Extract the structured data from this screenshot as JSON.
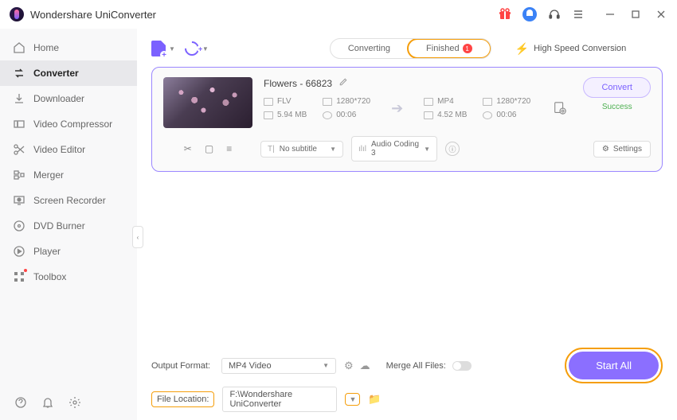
{
  "app": {
    "title": "Wondershare UniConverter"
  },
  "sidebar": {
    "items": [
      {
        "label": "Home"
      },
      {
        "label": "Converter"
      },
      {
        "label": "Downloader"
      },
      {
        "label": "Video Compressor"
      },
      {
        "label": "Video Editor"
      },
      {
        "label": "Merger"
      },
      {
        "label": "Screen Recorder"
      },
      {
        "label": "DVD Burner"
      },
      {
        "label": "Player"
      },
      {
        "label": "Toolbox"
      }
    ]
  },
  "topbar": {
    "tabs": {
      "converting": "Converting",
      "finished": "Finished",
      "finished_count": "1"
    },
    "high_speed": "High Speed Conversion"
  },
  "task": {
    "title": "Flowers - 66823",
    "src": {
      "format": "FLV",
      "res": "1280*720",
      "size": "5.94 MB",
      "dur": "00:06"
    },
    "dst": {
      "format": "MP4",
      "res": "1280*720",
      "size": "4.52 MB",
      "dur": "00:06"
    },
    "subtitle": "No subtitle",
    "audio": "Audio Coding 3",
    "settings": "Settings",
    "convert": "Convert",
    "status": "Success"
  },
  "bottom": {
    "output_label": "Output Format:",
    "output_value": "MP4 Video",
    "merge_label": "Merge All Files:",
    "location_label": "File Location:",
    "location_value": "F:\\Wondershare UniConverter",
    "start_all": "Start All"
  }
}
